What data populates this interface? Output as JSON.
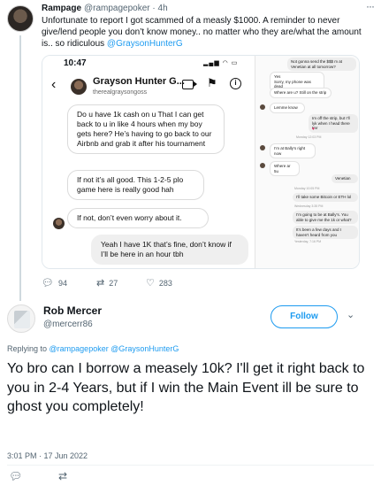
{
  "tweet": {
    "name": "Rampage",
    "handle": "@rampagepoker",
    "time": "· 4h",
    "text_pre": "Unfortunate to report I got scammed of a measly $1000. A reminder to never give/lend people you don’t know money.. no matter who they are/what the amount is.. so ridiculous ",
    "text_mention": "@GraysonHunterG",
    "stats": {
      "replies": "94",
      "retweets": "27",
      "likes": "283"
    }
  },
  "screenshot": {
    "status_time": "10:47",
    "contact_name": "Grayson Hunter G...",
    "contact_handle": "therealgraysongoss",
    "messages": [
      {
        "text": "Do u have 1k cash on u That I can get back to u in like 4 hours when my boy gets here? He’s having to go back to our Airbnb and grab it after his tournament"
      },
      {
        "text": "If not it’s all good. This 1-2-5 plo game here is really good hah"
      },
      {
        "text": "If not, don’t even worry about it."
      },
      {
        "text": "Yeah I have 1K that’s fine, don’t know if I’ll be here in an hour tbh"
      }
    ],
    "side_messages": [
      "Yes\nSorry, my phone was dead",
      "Where are u? Still on the strip",
      "Lemme know",
      "Im off the strip, but I’ll lyk when I head there tmr",
      "Monday 12:03 PM",
      "I’m at Bally’s right now",
      "Where ar 5u",
      "Venetian",
      "Monday 10:05 PM",
      "I’ll take some Bitcoin or ETH lol",
      "Wednesday 3:35 PM",
      "I’m going to be at Bally’s. You able to give me the 1k or what?",
      "It’s been a few days and I haven’t heard from you",
      "Yesterday, 7:16 PM"
    ],
    "side_top": "Not gonna send the $$$ m at Venetian at all tomorrow?"
  },
  "reply": {
    "name": "Rob Mercer",
    "handle": "@mercerr86",
    "follow_label": "Follow",
    "replying_prefix": "Replying to ",
    "replying_mentions": "@rampagepoker @GraysonHunterG",
    "text": "Yo bro can I borrow a measely 10k? I'll get it right back to you in 2-4 Years, but if I win the Main Event ill be sure to ghost you completely!",
    "timestamp": "3:01 PM · 17 Jun 2022"
  },
  "icons": {
    "reply": "reply-icon",
    "retweet": "retweet-icon",
    "like": "heart-icon",
    "share": "share-icon",
    "more": "more-icon"
  },
  "colors": {
    "accent": "#1d9bf0",
    "text": "#0f1419",
    "muted": "#536471"
  }
}
